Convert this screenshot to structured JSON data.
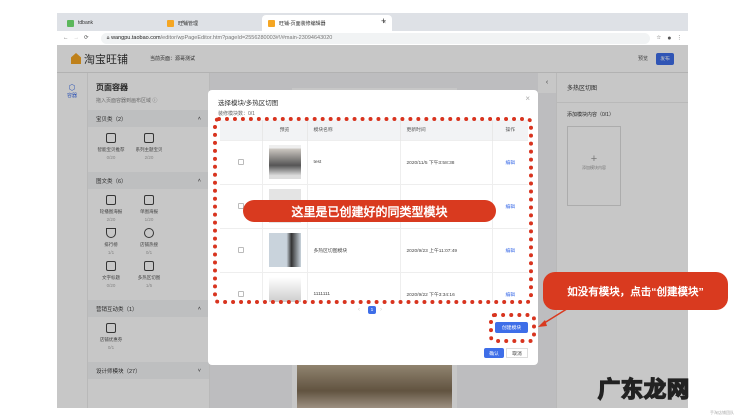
{
  "browser": {
    "tabs": [
      {
        "label": "tdbank"
      },
      {
        "label": "旺铺管理"
      },
      {
        "label": "旺铺-页面装修编辑器"
      }
    ],
    "new_tab": "+",
    "close": "×",
    "url_host": "wangpu.taobao.com",
    "url_path": "/editor/wpPageEditor.htm?pageId=2556280003#!/#main-23094643020"
  },
  "header": {
    "logo": "淘宝旺铺",
    "current_page": "当前页面：源哥测试",
    "preview": "预览",
    "publish": "发布"
  },
  "rail": {
    "item": "容器"
  },
  "panel": {
    "title": "页面容器",
    "hint": "拖入页面容器到画布区域",
    "sections": [
      {
        "label": "宝贝类（2）",
        "items": [
          {
            "name": "智能宝贝推荐",
            "count": "0/20"
          },
          {
            "name": "系列主题宝贝",
            "count": "2/20"
          }
        ]
      },
      {
        "label": "图文类（6）",
        "items": [
          {
            "name": "轮播图海报",
            "count": "2/20"
          },
          {
            "name": "单图海报",
            "count": "1/20"
          },
          {
            "name": "排行榜",
            "count": "1/1"
          },
          {
            "name": "店铺热搜",
            "count": "0/1"
          },
          {
            "name": "文字标题",
            "count": "0/20"
          },
          {
            "name": "多热区切图",
            "count": "1/5"
          }
        ]
      },
      {
        "label": "营销互动类（1）",
        "items": [
          {
            "name": "店铺优惠券",
            "count": "0/1"
          }
        ]
      },
      {
        "label": "设计师模块（27）",
        "items": []
      }
    ]
  },
  "right": {
    "title": "多热区切图",
    "sub": "添加模块内容（0/1）",
    "add": "添加模块内容"
  },
  "modal": {
    "title": "选择模块/多热区切图",
    "count": "装修模块数：0/1",
    "columns": [
      "预览",
      "模块名称",
      "更新时间",
      "操作"
    ],
    "rows": [
      {
        "name": "test",
        "time": "2020/11/5 下午3:58:38",
        "op": "编辑"
      },
      {
        "name": "",
        "time": "",
        "op": "编辑"
      },
      {
        "name": "多热区切图模块",
        "time": "2020/9/23 上午11:07:49",
        "op": "编辑"
      },
      {
        "name": "1111111",
        "time": "2020/9/22 下午3:34:16",
        "op": "编辑"
      }
    ],
    "page": "1",
    "create": "创建模块",
    "confirm": "确认",
    "cancel": "取消"
  },
  "annotations": {
    "banner": "这里是已创建好的同类型模块",
    "callout": "如没有模块，点击“创建模块”"
  },
  "watermark": {
    "logo": "广东龙网",
    "credit": "手淘店铺团队"
  }
}
